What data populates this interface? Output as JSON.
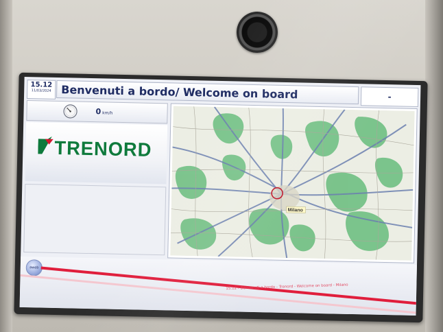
{
  "header": {
    "time": "15.12",
    "date": "11/03/2024",
    "title": "Benvenuti a bordo/ Welcome on board",
    "right_status": "-"
  },
  "speed": {
    "value": "0",
    "unit": "km/h"
  },
  "brand": {
    "name": "TRENORD",
    "logo_color": "#0f7a3c",
    "accent_color": "#d1192f"
  },
  "map": {
    "city_label": "Milano",
    "marker_color": "#c0182a",
    "land_color": "#eceee4",
    "green_color": "#6fbf82",
    "road_color": "#6b7fb0"
  },
  "footer": {
    "badge": "aweb",
    "ticker": "15.12 - Benvenuti a bordo - Trenord - Welcome on board - Milano"
  },
  "colors": {
    "title_text": "#1f2c63",
    "stripe": "#e01e3c"
  }
}
